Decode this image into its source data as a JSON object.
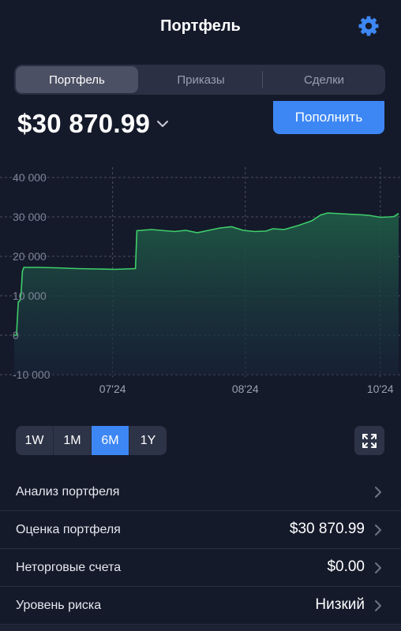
{
  "header": {
    "title": "Портфель"
  },
  "icons": {
    "settings": "gear-icon",
    "expand": "expand-icon",
    "chevron": "chevron-right-icon",
    "dropdown": "chevron-down-icon"
  },
  "colors": {
    "accent": "#3d87f5",
    "line": "#3ecf6a",
    "background": "#151a2b"
  },
  "tabs": [
    {
      "label": "Портфель",
      "active": true
    },
    {
      "label": "Приказы",
      "active": false
    },
    {
      "label": "Сделки",
      "active": false
    }
  ],
  "balance": {
    "value": "$30 870.99"
  },
  "topup_button": {
    "label": "Пополнить"
  },
  "periods": [
    {
      "label": "1W",
      "active": false
    },
    {
      "label": "1M",
      "active": false
    },
    {
      "label": "6M",
      "active": true
    },
    {
      "label": "1Y",
      "active": false
    }
  ],
  "rows": [
    {
      "label": "Анализ портфеля",
      "value": ""
    },
    {
      "label": "Оценка портфеля",
      "value": "$30 870.99"
    },
    {
      "label": "Неторговые счета",
      "value": "$0.00"
    },
    {
      "label": "Уровень риска",
      "value": "Низкий"
    }
  ],
  "chart_data": {
    "type": "area",
    "title": "",
    "xlabel": "",
    "ylabel": "",
    "ylim": [
      -10000,
      40000
    ],
    "y_ticks": [
      "40 000",
      "30 000",
      "20 000",
      "10 000",
      "0",
      "-10 000"
    ],
    "y_tick_values": [
      40000,
      30000,
      20000,
      10000,
      0,
      -10000
    ],
    "x_ticks": [
      "07'24",
      "08'24",
      "10'24"
    ],
    "x_tick_days": [
      43,
      101,
      160
    ],
    "grid": true,
    "series": [
      {
        "x_days": [
          0,
          1,
          1.8,
          2.5,
          3,
          3.6,
          4.2,
          10,
          18,
          27,
          36,
          44,
          53,
          53.6,
          60,
          66,
          70,
          75,
          80,
          85,
          90,
          95,
          100,
          105,
          110,
          113,
          118,
          124,
          130,
          134,
          137,
          140,
          143,
          146,
          150,
          155,
          160,
          164,
          166,
          168
        ],
        "values": [
          0,
          0,
          8500,
          8700,
          10500,
          16200,
          17200,
          17200,
          17100,
          16900,
          16800,
          16700,
          16900,
          26500,
          26800,
          26500,
          26300,
          26600,
          26000,
          26600,
          27200,
          27500,
          26600,
          26300,
          26400,
          27000,
          26800,
          27800,
          29000,
          30500,
          31000,
          30900,
          30800,
          30700,
          30600,
          30400,
          29900,
          30000,
          30100,
          30870.99
        ]
      }
    ]
  }
}
